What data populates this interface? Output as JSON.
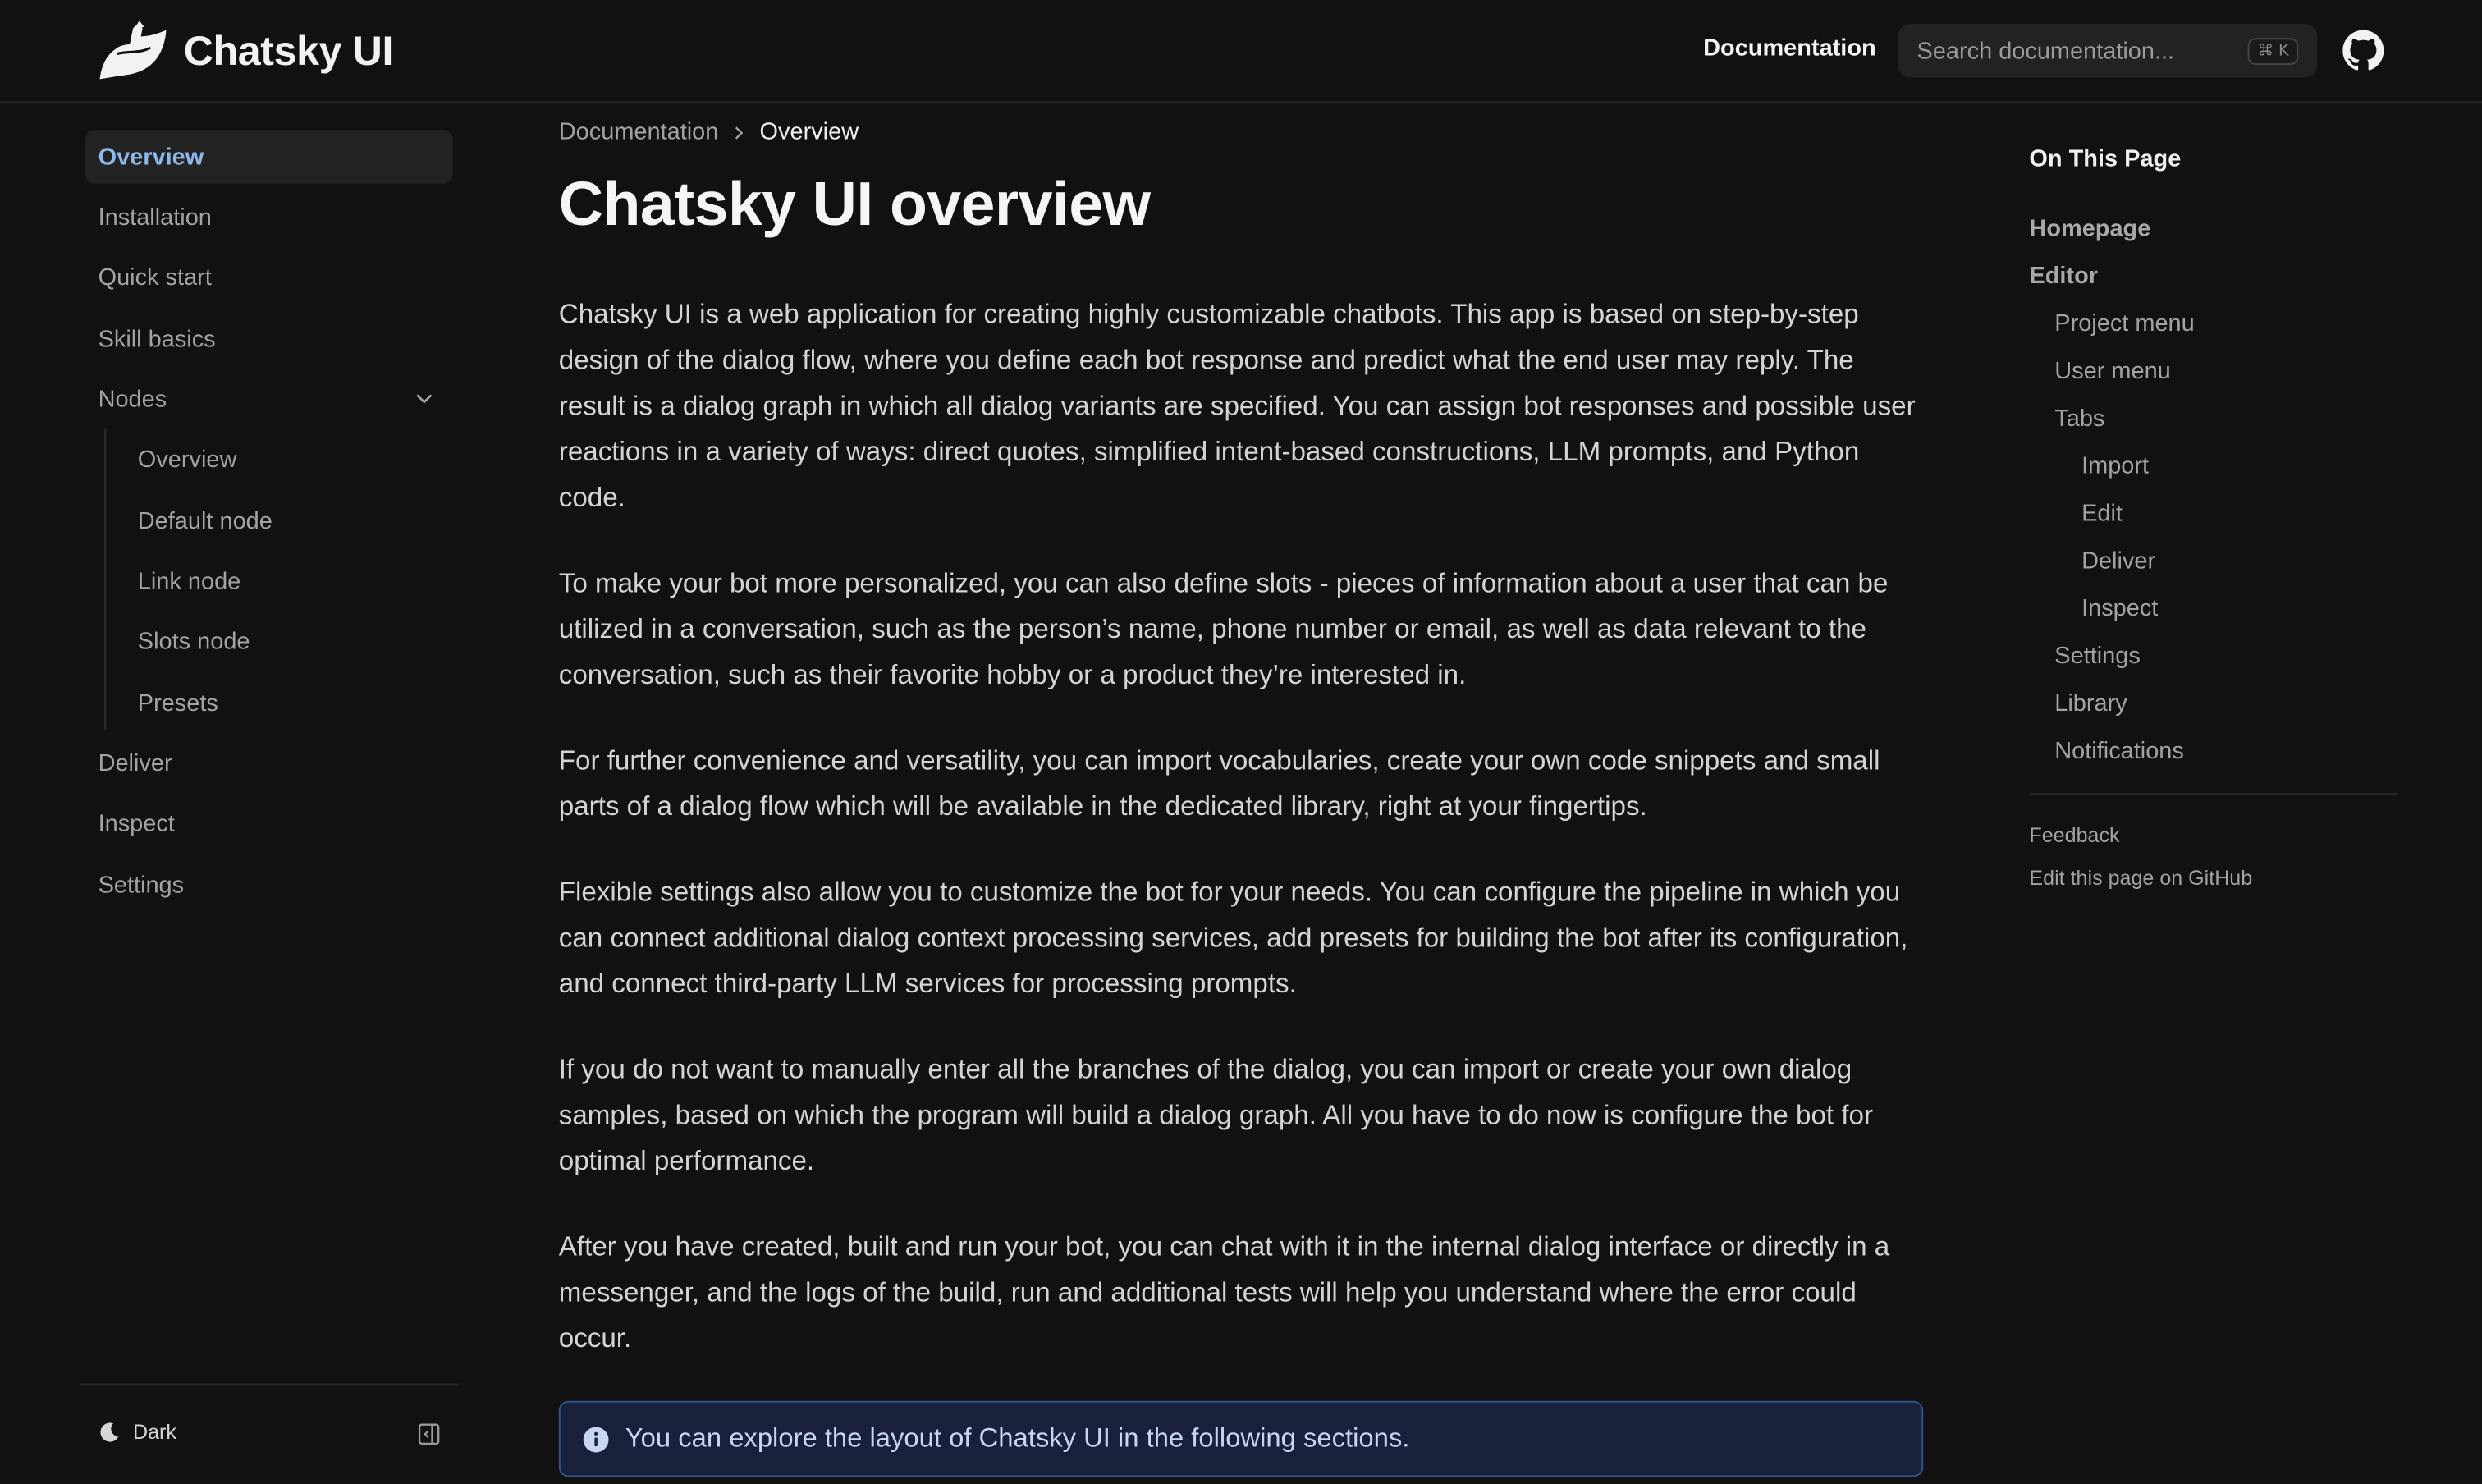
{
  "header": {
    "brand": "Chatsky UI",
    "nav_link": "Documentation",
    "search": {
      "placeholder": "Search documentation...",
      "shortcut": "⌘ K"
    },
    "github_icon": "github-icon"
  },
  "sidebar": {
    "items": [
      {
        "label": "Overview",
        "active": true
      },
      {
        "label": "Installation"
      },
      {
        "label": "Quick start"
      },
      {
        "label": "Skill basics"
      },
      {
        "label": "Nodes",
        "expanded": true
      },
      {
        "label": "Deliver"
      },
      {
        "label": "Inspect"
      },
      {
        "label": "Settings"
      }
    ],
    "nodes_children": [
      "Overview",
      "Default node",
      "Link node",
      "Slots node",
      "Presets"
    ],
    "footer": {
      "theme_label": "Dark"
    }
  },
  "main": {
    "breadcrumb": [
      "Documentation",
      "Overview"
    ],
    "title": "Chatsky UI overview",
    "paragraphs": [
      "Chatsky UI is a web application for creating highly customizable chatbots. This app is based on step-by-step design of the dialog flow, where you define each bot response and predict what the end user may reply. The result is a dialog graph in which all dialog variants are specified. You can assign bot responses and possible user reactions in a variety of ways: direct quotes, simplified intent-based constructions, LLM prompts, and Python code.",
      "To make your bot more personalized, you can also define slots - pieces of information about a user that can be utilized in a conversation, such as the person’s name, phone number or email, as well as data relevant to the conversation, such as their favorite hobby or a product they’re interested in.",
      "For further convenience and versatility, you can import vocabularies, create your own code snippets and small parts of a dialog flow which will be available in the dedicated library, right at your fingertips.",
      "Flexible settings also allow you to customize the bot for your needs. You can configure the pipeline in which you can connect additional dialog context processing services, add presets for building the bot after its configuration, and connect third-party LLM services for processing prompts.",
      "If you do not want to manually enter all the branches of the dialog, you can import or create your own dialog samples, based on which the program will build a dialog graph. All you have to do now is configure the bot for optimal performance.",
      "After you have created, built and run your bot, you can chat with it in the internal dialog interface or directly in a messenger, and the logs of the build, run and additional tests will help you understand where the error could occur."
    ],
    "callout": "You can explore the layout of Chatsky UI in the following sections."
  },
  "toc": {
    "title": "On This Page",
    "links": [
      {
        "label": "Homepage",
        "level": 1
      },
      {
        "label": "Editor",
        "level": 1
      },
      {
        "label": "Project menu",
        "level": 2
      },
      {
        "label": "User menu",
        "level": 2
      },
      {
        "label": "Tabs",
        "level": 2
      },
      {
        "label": "Import",
        "level": 3
      },
      {
        "label": "Edit",
        "level": 3
      },
      {
        "label": "Deliver",
        "level": 3
      },
      {
        "label": "Inspect",
        "level": 3
      },
      {
        "label": "Settings",
        "level": 2
      },
      {
        "label": "Library",
        "level": 2
      },
      {
        "label": "Notifications",
        "level": 2
      }
    ],
    "feedback": "Feedback",
    "edit_on_github": "Edit this page on GitHub"
  },
  "colors": {
    "background": "#111111",
    "active_link": "#8fb8ea",
    "callout_border": "#35528f",
    "callout_bg": "#18203a"
  }
}
